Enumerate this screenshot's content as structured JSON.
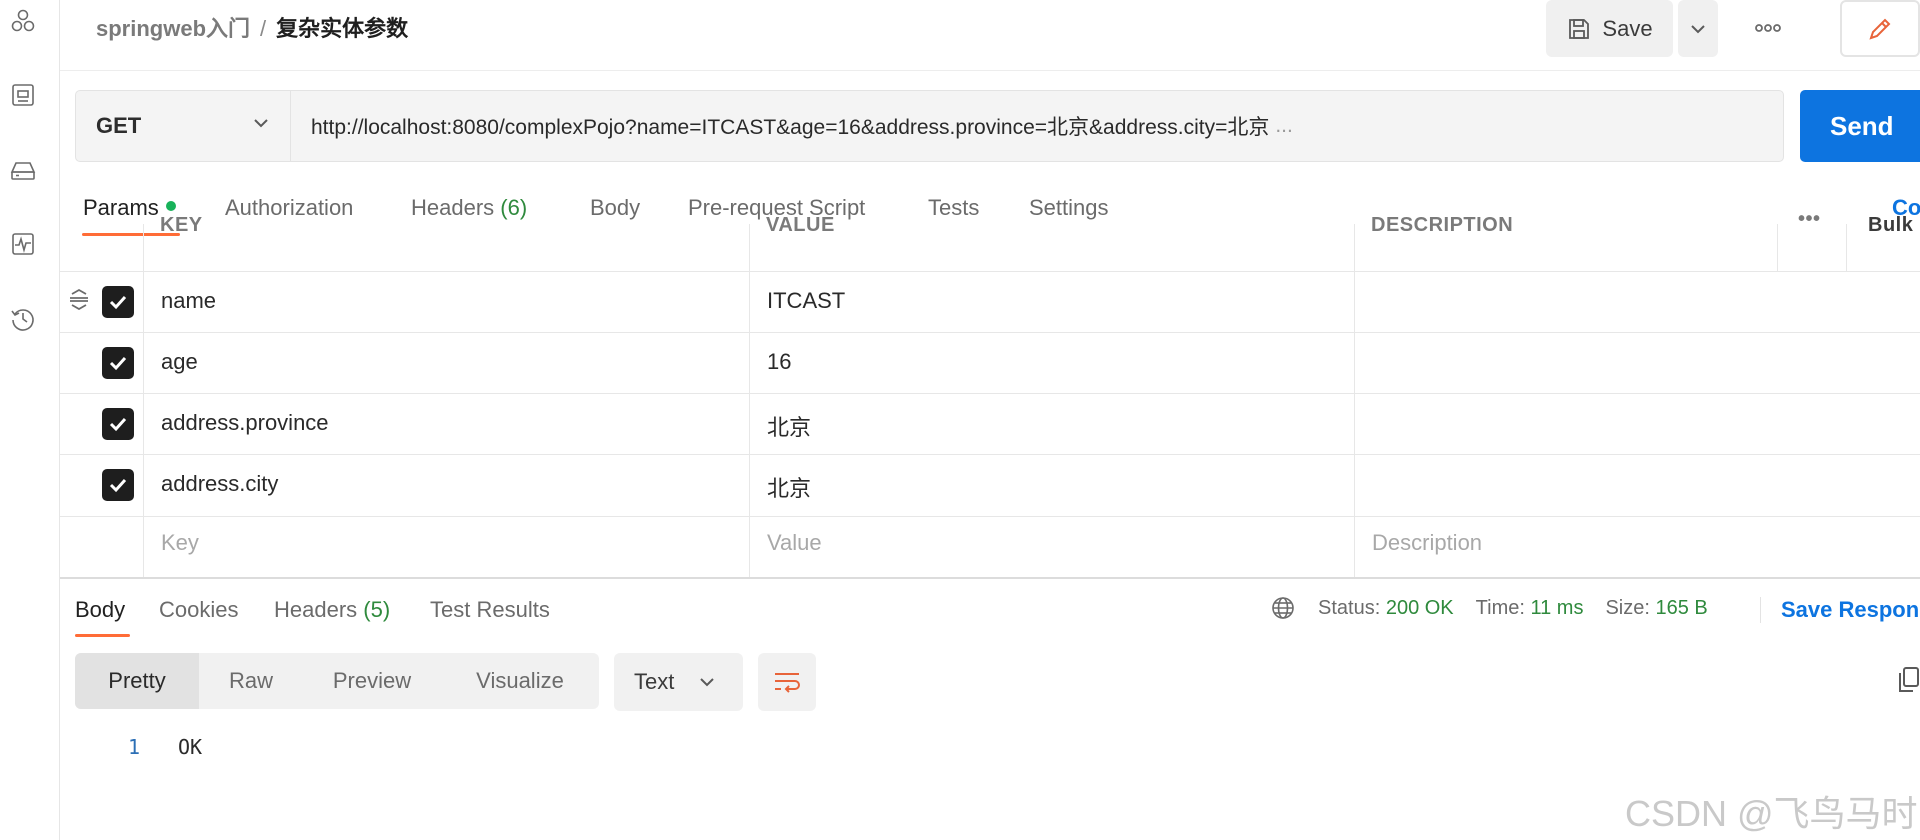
{
  "header": {
    "breadcrumb_parent": "springweb入门",
    "breadcrumb_separator": "/",
    "breadcrumb_current": "复杂实体参数",
    "save_label": "Save"
  },
  "request": {
    "method": "GET",
    "url": "http://localhost:8080/complexPojo?name=ITCAST&age=16&address.province=北京&address.city=北京",
    "url_ellipsis": "...",
    "send_label": "Send"
  },
  "request_tabs": {
    "params": "Params",
    "authorization": "Authorization",
    "headers": "Headers",
    "headers_count": "(6)",
    "body": "Body",
    "prerequest": "Pre-request Script",
    "tests": "Tests",
    "settings": "Settings",
    "cookies": "Co"
  },
  "params_table": {
    "columns": {
      "key": "KEY",
      "value": "VALUE",
      "description": "DESCRIPTION",
      "more": "•••",
      "bulk": "Bulk"
    },
    "rows": [
      {
        "key": "name",
        "value": "ITCAST"
      },
      {
        "key": "age",
        "value": "16"
      },
      {
        "key": "address.province",
        "value": "北京"
      },
      {
        "key": "address.city",
        "value": "北京"
      }
    ],
    "placeholders": {
      "key": "Key",
      "value": "Value",
      "description": "Description"
    }
  },
  "response": {
    "tabs": {
      "body": "Body",
      "cookies": "Cookies",
      "headers": "Headers",
      "headers_count": "(5)",
      "test_results": "Test Results"
    },
    "status_label": "Status:",
    "status_value": "200 OK",
    "time_label": "Time:",
    "time_value": "11 ms",
    "size_label": "Size:",
    "size_value": "165 B",
    "save_response": "Save Respon",
    "view_modes": {
      "pretty": "Pretty",
      "raw": "Raw",
      "preview": "Preview",
      "visualize": "Visualize"
    },
    "format": "Text",
    "body_lines": [
      {
        "number": "1",
        "text": "OK"
      }
    ]
  },
  "watermark": "CSDN @飞鸟马时",
  "colors": {
    "accent_orange": "#ff6c37",
    "send_blue": "#0d74e0",
    "success_green": "#2f8a3d"
  },
  "icons": [
    "apis-icon",
    "environments-icon",
    "mock-servers-icon",
    "monitors-icon",
    "history-icon",
    "save-icon",
    "chevron-down-icon",
    "more-icon",
    "edit-icon",
    "drag-handle-icon",
    "checkbox-checked-icon",
    "globe-icon",
    "wrap-lines-icon",
    "copy-icon"
  ]
}
